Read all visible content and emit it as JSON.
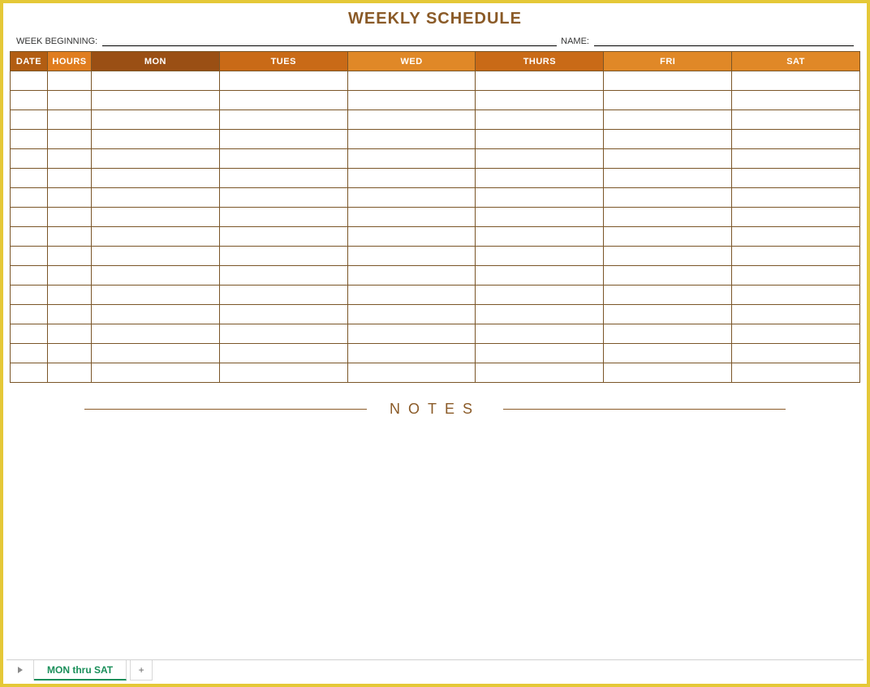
{
  "title": "WEEKLY SCHEDULE",
  "meta": {
    "week_beginning_label": "WEEK BEGINNING:",
    "week_beginning_value": "",
    "name_label": "NAME:",
    "name_value": ""
  },
  "headers": {
    "date": "DATE",
    "hours": "HOURS",
    "mon": "MON",
    "tues": "TUES",
    "wed": "WED",
    "thurs": "THURS",
    "fri": "FRI",
    "sat": "SAT"
  },
  "rows": [
    {
      "date": "",
      "hours": "",
      "mon": "",
      "tues": "",
      "wed": "",
      "thurs": "",
      "fri": "",
      "sat": ""
    },
    {
      "date": "",
      "hours": "",
      "mon": "",
      "tues": "",
      "wed": "",
      "thurs": "",
      "fri": "",
      "sat": ""
    },
    {
      "date": "",
      "hours": "",
      "mon": "",
      "tues": "",
      "wed": "",
      "thurs": "",
      "fri": "",
      "sat": ""
    },
    {
      "date": "",
      "hours": "",
      "mon": "",
      "tues": "",
      "wed": "",
      "thurs": "",
      "fri": "",
      "sat": ""
    },
    {
      "date": "",
      "hours": "",
      "mon": "",
      "tues": "",
      "wed": "",
      "thurs": "",
      "fri": "",
      "sat": ""
    },
    {
      "date": "",
      "hours": "",
      "mon": "",
      "tues": "",
      "wed": "",
      "thurs": "",
      "fri": "",
      "sat": ""
    },
    {
      "date": "",
      "hours": "",
      "mon": "",
      "tues": "",
      "wed": "",
      "thurs": "",
      "fri": "",
      "sat": ""
    },
    {
      "date": "",
      "hours": "",
      "mon": "",
      "tues": "",
      "wed": "",
      "thurs": "",
      "fri": "",
      "sat": ""
    },
    {
      "date": "",
      "hours": "",
      "mon": "",
      "tues": "",
      "wed": "",
      "thurs": "",
      "fri": "",
      "sat": ""
    },
    {
      "date": "",
      "hours": "",
      "mon": "",
      "tues": "",
      "wed": "",
      "thurs": "",
      "fri": "",
      "sat": ""
    },
    {
      "date": "",
      "hours": "",
      "mon": "",
      "tues": "",
      "wed": "",
      "thurs": "",
      "fri": "",
      "sat": ""
    },
    {
      "date": "",
      "hours": "",
      "mon": "",
      "tues": "",
      "wed": "",
      "thurs": "",
      "fri": "",
      "sat": ""
    },
    {
      "date": "",
      "hours": "",
      "mon": "",
      "tues": "",
      "wed": "",
      "thurs": "",
      "fri": "",
      "sat": ""
    },
    {
      "date": "",
      "hours": "",
      "mon": "",
      "tues": "",
      "wed": "",
      "thurs": "",
      "fri": "",
      "sat": ""
    },
    {
      "date": "",
      "hours": "",
      "mon": "",
      "tues": "",
      "wed": "",
      "thurs": "",
      "fri": "",
      "sat": ""
    },
    {
      "date": "",
      "hours": "",
      "mon": "",
      "tues": "",
      "wed": "",
      "thurs": "",
      "fri": "",
      "sat": ""
    }
  ],
  "notes": {
    "label": "NOTES"
  },
  "sheet_tabs": {
    "active": "MON thru SAT",
    "add": "+"
  }
}
